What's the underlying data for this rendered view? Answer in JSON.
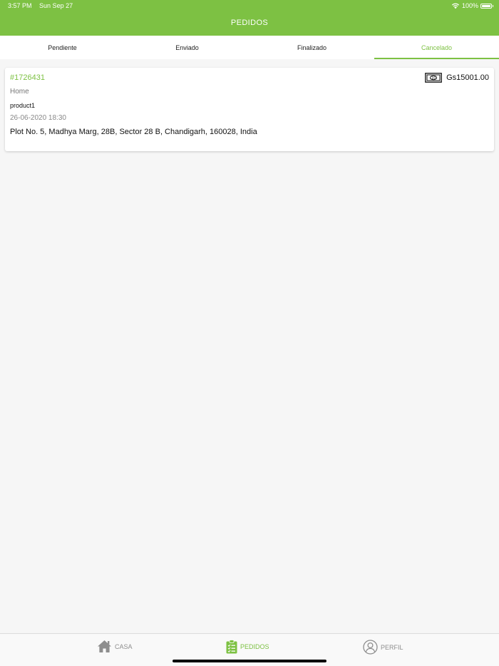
{
  "status_bar": {
    "time": "3:57 PM",
    "date": "Sun Sep 27",
    "battery": "100%"
  },
  "header": {
    "title": "PEDIDOS"
  },
  "tabs": [
    {
      "label": "Pendiente",
      "active": false
    },
    {
      "label": "Enviado",
      "active": false
    },
    {
      "label": "Finalizado",
      "active": false
    },
    {
      "label": "Cancelado",
      "active": true
    }
  ],
  "orders": [
    {
      "id": "#1726431",
      "price": "Gs15001.00",
      "type": "Home",
      "product": "product1",
      "datetime": "26-06-2020 18:30",
      "address": "Plot No. 5, Madhya Marg, 28B, Sector 28 B, Chandigarh, 160028, India"
    }
  ],
  "bottom_nav": {
    "casa": "CASA",
    "pedidos": "PEDIDOS",
    "perfil": "PERFIL"
  },
  "icons": {
    "wifi": "wifi-icon",
    "battery": "battery-icon",
    "money": "money-icon",
    "home": "home-icon",
    "orders": "clipboard-icon",
    "profile": "user-icon"
  },
  "colors": {
    "accent": "#7dc143",
    "background": "#f6f6f6",
    "inactive": "#8e8e8e"
  }
}
